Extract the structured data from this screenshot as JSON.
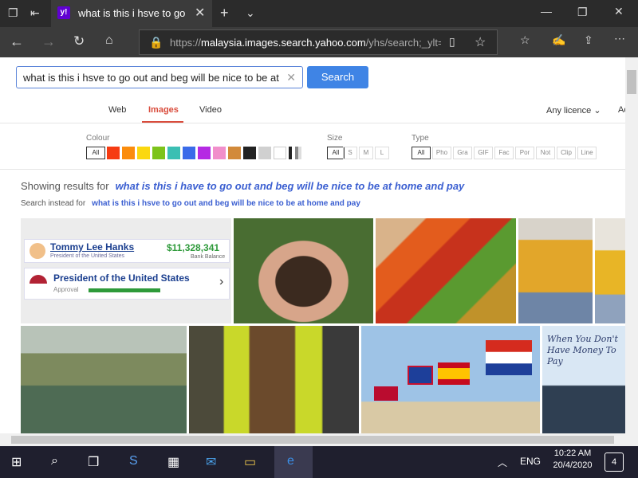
{
  "browser": {
    "tab_title": "what is this i hsve to go",
    "favicon_label": "y!",
    "url_prefix": "https://",
    "url_host": "malaysia.images.search.yahoo.com",
    "url_path": "/yhs/search;_ylt=..."
  },
  "search": {
    "query": "what is this i hsve to go out and beg will be nice to be at h",
    "button_label": "Search"
  },
  "nav": {
    "tabs": [
      "Web",
      "Images",
      "Video"
    ],
    "active": "Images",
    "licence": "Any licence",
    "extra": "Ac"
  },
  "filters": {
    "colour_label": "Colour",
    "colour_all": "All",
    "colours": [
      "#f63b12",
      "#fb8c0c",
      "#fbd80f",
      "#7dc31b",
      "#3bbfb3",
      "#3a6be9",
      "#b52ae3",
      "#f18fcb",
      "#d28a3a",
      "#222222",
      "#d0d0d0",
      "#ffffff"
    ],
    "size_label": "Size",
    "sizes": [
      "All",
      "S",
      "M",
      "L"
    ],
    "type_label": "Type",
    "types": [
      "All",
      "Pho",
      "Gra",
      "GIF",
      "Fac",
      "Por",
      "Not",
      "Clip",
      "Line"
    ]
  },
  "results": {
    "showing_label": "Showing results for",
    "corrected_query": "what is this i have to go out and beg will be nice to be at home and pay",
    "instead_label": "Search instead for",
    "original_query": "what is this i hsve to go out and beg will be nice to be at home and pay",
    "card": {
      "name": "Tommy Lee Hanks",
      "role": "President of the United States",
      "amount": "$11,328,341",
      "amount_label": "Bank Balance",
      "title": "President of the United States",
      "sub": "Approval"
    },
    "caption_text": "When You Don't Have Money To Pay"
  },
  "taskbar": {
    "language": "ENG",
    "time": "10:22 AM",
    "date": "20/4/2020",
    "notifications": "4"
  }
}
